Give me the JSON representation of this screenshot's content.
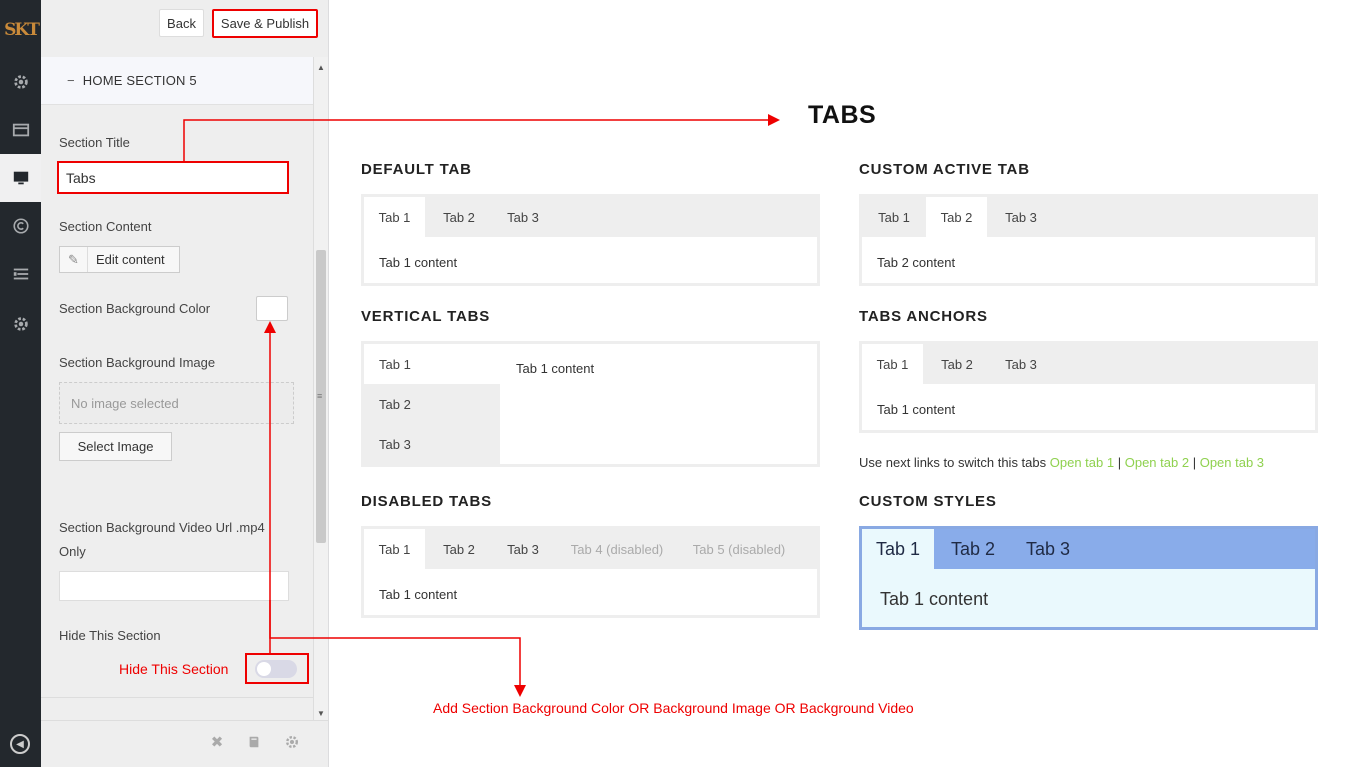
{
  "rail": {
    "logo": "SKT",
    "icons": [
      "gear-icon",
      "card-icon",
      "monitor-icon",
      "copyright-icon",
      "list-icon",
      "gear-icon",
      "collapse-icon"
    ]
  },
  "panel": {
    "back_label": "Back",
    "publish_label": "Save & Publish",
    "section_heading": "HOME SECTION 5",
    "section_title_label": "Section Title",
    "section_title_value": "Tabs",
    "section_content_label": "Section Content",
    "edit_content_label": "Edit content",
    "bg_color_label": "Section Background Color",
    "bg_image_label": "Section Background Image",
    "no_image_text": "No image selected",
    "select_image_label": "Select Image",
    "bg_video_label_line1": "Section Background Video Url .mp4",
    "bg_video_label_line2": "Only",
    "bg_video_value": "",
    "hide_label": "Hide This Section",
    "hide_red_label": "Hide This Section",
    "hide_enabled": false
  },
  "preview": {
    "title": "TABS",
    "default_tab": {
      "heading": "DEFAULT TAB",
      "tabs": [
        "Tab 1",
        "Tab 2",
        "Tab 3"
      ],
      "active": 0,
      "content": "Tab 1 content"
    },
    "custom_active_tab": {
      "heading": "CUSTOM ACTIVE TAB",
      "tabs": [
        "Tab 1",
        "Tab 2",
        "Tab 3"
      ],
      "active": 1,
      "content": "Tab 2 content"
    },
    "vertical_tabs": {
      "heading": "VERTICAL TABS",
      "tabs": [
        "Tab 1",
        "Tab 2",
        "Tab 3"
      ],
      "active": 0,
      "content": "Tab 1 content"
    },
    "tabs_anchors": {
      "heading": "TABS ANCHORS",
      "tabs": [
        "Tab 1",
        "Tab 2",
        "Tab 3"
      ],
      "active": 0,
      "content": "Tab 1 content"
    },
    "switch_links": {
      "prefix": "Use next links to switch this tabs",
      "links": [
        "Open tab 1",
        "Open tab 2",
        "Open tab 3"
      ],
      "separator": "|",
      "link_color": "#8fd14f"
    },
    "disabled_tabs": {
      "heading": "DISABLED TABS",
      "tabs": [
        "Tab 1",
        "Tab 2",
        "Tab 3",
        "Tab 4 (disabled)",
        "Tab 5 (disabled)"
      ],
      "active": 0,
      "content": "Tab 1 content"
    },
    "custom_styles": {
      "heading": "CUSTOM STYLES",
      "tabs": [
        "Tab 1",
        "Tab 2",
        "Tab 3"
      ],
      "active": 0,
      "content": "Tab 1 content",
      "bar_color": "#89acea",
      "content_bg": "#eaf9fd"
    },
    "annotation": "Add Section Background Color OR Background Image OR Background Video",
    "annotation_color": "#ee0000"
  }
}
